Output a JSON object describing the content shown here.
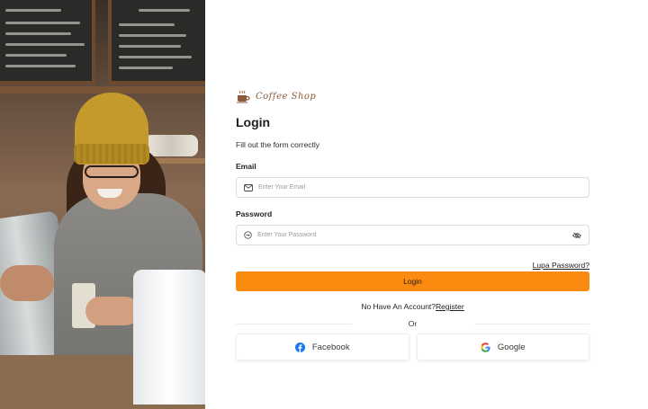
{
  "brand": {
    "name": "Coffee Shop",
    "icon": "coffee-cup-icon"
  },
  "form": {
    "title": "Login",
    "subtitle": "Fill out the form correctly",
    "email": {
      "label": "Email",
      "placeholder": "Enter Your Email",
      "icon": "envelope-icon"
    },
    "password": {
      "label": "Password",
      "placeholder": "Enter Your Password",
      "icon": "key-icon",
      "toggle_icon": "eye-off-icon"
    },
    "forgot_label": "Lupa Password?",
    "login_label": "Login",
    "no_account_text": "No Have An Account?",
    "register_label": "Register",
    "or_label": "Or",
    "social": [
      {
        "label": "Facebook",
        "icon": "facebook-icon"
      },
      {
        "label": "Google",
        "icon": "google-icon"
      }
    ]
  },
  "colors": {
    "accent": "#fb8b10",
    "facebook": "#1877f2",
    "brand_brown": "#8a5a3a"
  }
}
